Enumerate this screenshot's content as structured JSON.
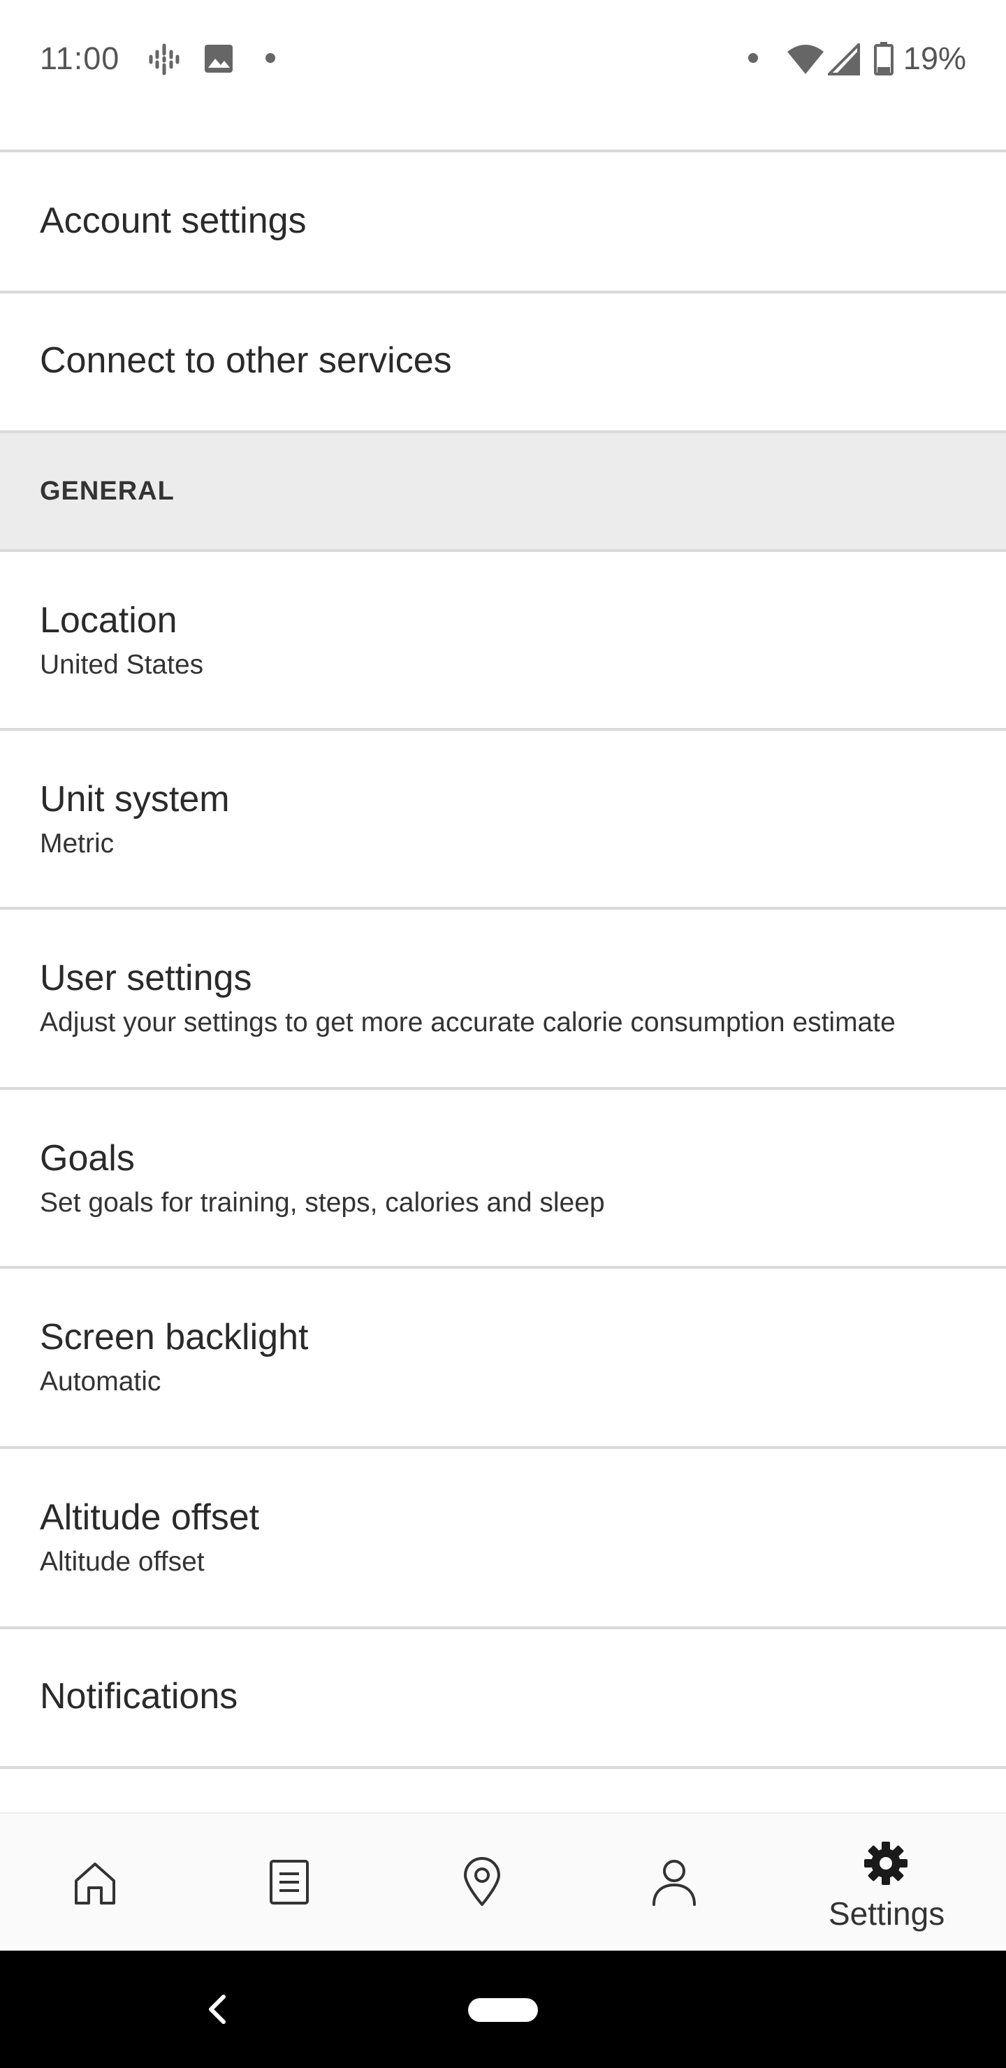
{
  "status_bar": {
    "time": "11:00",
    "battery": "19%",
    "icons_left": [
      "podcast-icon",
      "image-icon",
      "dot-icon"
    ],
    "icons_right": [
      "dot-icon",
      "wifi-icon",
      "signal-icon",
      "battery-icon"
    ]
  },
  "list": {
    "account_settings": {
      "title": "Account settings"
    },
    "connect_services": {
      "title": "Connect to other services"
    },
    "section_general": "GENERAL",
    "location": {
      "title": "Location",
      "subtitle": "United States"
    },
    "unit_system": {
      "title": "Unit system",
      "subtitle": "Metric"
    },
    "user_settings": {
      "title": "User settings",
      "subtitle": "Adjust your settings to get more accurate calorie consumption estimate"
    },
    "goals": {
      "title": "Goals",
      "subtitle": "Set goals for training, steps, calories and sleep"
    },
    "screen_backlight": {
      "title": "Screen backlight",
      "subtitle": "Automatic"
    },
    "altitude_offset": {
      "title": "Altitude offset",
      "subtitle": "Altitude offset"
    },
    "notifications": {
      "title": "Notifications"
    }
  },
  "bottom_nav": {
    "items": [
      {
        "icon": "home-icon"
      },
      {
        "icon": "diary-icon"
      },
      {
        "icon": "map-pin-icon"
      },
      {
        "icon": "profile-icon"
      },
      {
        "icon": "gear-icon",
        "label": "Settings",
        "active": true
      }
    ]
  },
  "system_nav": {
    "icons": [
      "back-icon",
      "home-pill-icon"
    ]
  }
}
